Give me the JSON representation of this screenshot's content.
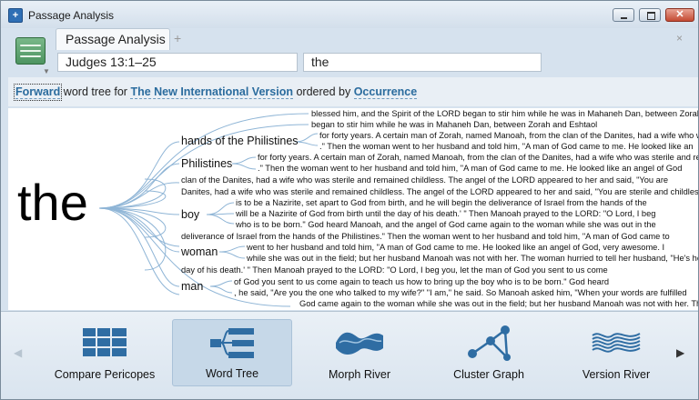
{
  "window": {
    "title": "Passage Analysis"
  },
  "tab": {
    "label": "Passage Analysis",
    "add": "+",
    "close": "×"
  },
  "reference": {
    "value": "Judges 13:1–25"
  },
  "search": {
    "value": "the"
  },
  "options": {
    "direction": "Forward",
    "text1": "word tree for",
    "bible": "The New International Version",
    "text2": "ordered by",
    "order": "Occurrence"
  },
  "tree": {
    "root": "the",
    "nodes": [
      {
        "label": "hands of the Philistines",
        "id": "n1"
      },
      {
        "label": "Philistines",
        "id": "n2"
      },
      {
        "label": "boy",
        "id": "n3"
      },
      {
        "label": "woman",
        "id": "n4"
      },
      {
        "label": "man",
        "id": "n5"
      }
    ],
    "contexts": [
      "blessed him, and the Spirit of the LORD began to stir him while he was in Mahaneh Dan, between Zorah and",
      "began to stir him while he was in Mahaneh Dan, between Zorah and Eshtaol",
      "for forty years.  A certain man of Zorah, named Manoah, from the clan of the Danites, had a wife who was",
      ".\"  Then the woman went to her husband and told him, \"A man of God came to me. He looked like an",
      "for forty years.  A certain man of Zorah, named Manoah, from the clan of the Danites, had a wife who was sterile and remained",
      ".\"  Then the woman went to her husband and told him, \"A man of God came to me. He looked like an angel of God",
      "clan of the Danites, had a wife who was sterile and remained childless. The angel of the LORD appeared to her and said, \"You are",
      "Danites, had a wife who was sterile and remained childless. The angel of the LORD appeared to her and said, \"You are sterile and childless",
      "is to be a Nazirite, set apart to God from birth, and he will begin the deliverance of Israel from the hands of the",
      "will be a Nazirite of God from birth until the day of his death.' \"  Then Manoah prayed to the LORD: \"O Lord, I beg",
      "who is to be born.\"  God heard Manoah, and the angel of God came again to the woman while she was out in the",
      "deliverance of Israel from the hands of the Philistines.\"  Then the woman went to her husband and told him, \"A man of God came to",
      "went to her husband and told him, \"A man of God came to me. He looked like an angel of God, very awesome. I",
      "while she was out in the field; but her husband Manoah was not with her. The woman hurried to tell her husband, \"He's here",
      "day of his death.' \"  Then Manoah prayed to the LORD: \"O Lord, I beg you, let the man of God you sent to us come",
      "of God you sent to us come again to teach us how to bring up the boy who is to be born.\"  God heard",
      ", he said, \"Are you the one who talked to my wife?\"  \"I am,\" he said.  So Manoah asked him, \"When your words are fulfilled",
      "God came again to the woman while she was out in the field; but her husband Manoah was not with her. The woma"
    ]
  },
  "picker": {
    "items": [
      {
        "label": "Compare Pericopes",
        "icon": "compare-pericopes-icon"
      },
      {
        "label": "Word Tree",
        "icon": "word-tree-icon"
      },
      {
        "label": "Morph River",
        "icon": "morph-river-icon"
      },
      {
        "label": "Cluster Graph",
        "icon": "cluster-graph-icon"
      },
      {
        "label": "Version River",
        "icon": "version-river-icon"
      }
    ],
    "selected": "Word Tree"
  },
  "colors": {
    "link": "#2b6c9e",
    "tree_line": "#8fb5d6",
    "icon_blue": "#2f6da3"
  }
}
